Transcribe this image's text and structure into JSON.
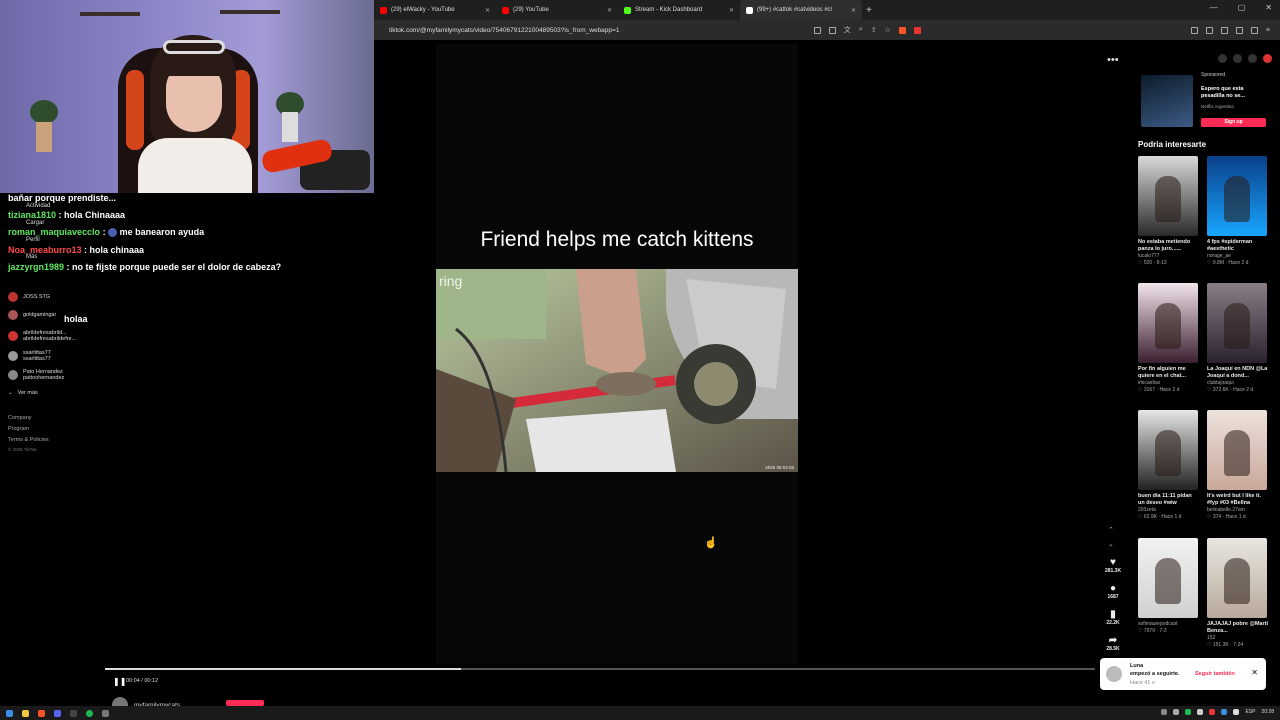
{
  "browser": {
    "tabs": [
      {
        "label": "(29) elWacky - YouTube",
        "color": "#ff0000",
        "active": false
      },
      {
        "label": "(29) YouTube",
        "color": "#ff0000",
        "active": false
      },
      {
        "label": "Stream - Kick Dashboard",
        "color": "#53fc18",
        "active": false
      },
      {
        "label": "(99+) #cattok #catvideos #cl",
        "color": "#ffffff",
        "active": true
      }
    ],
    "new_tab": "+",
    "url": "tiktok.com/@myfamilymycats/video/7540679122100489503?is_from_webapp=1"
  },
  "chat": {
    "lines": [
      {
        "user": "",
        "text": "bañar porque prendiste...",
        "user_color": "green"
      },
      {
        "user": "tiziana1810",
        "text": ": hola Chinaaaa",
        "user_color": "green"
      },
      {
        "user": "roman_maquiavecclo",
        "text": ":",
        "extra": "me banearon ayuda",
        "user_color": "green"
      },
      {
        "user": "Noa_meaburro13",
        "text": ": hola chinaaa",
        "user_color": "red"
      },
      {
        "user": "jazzyrgn1989",
        "text": ": no te fijste porque puede ser el dolor de cabeza?",
        "user_color": "green"
      },
      {
        "user": "",
        "text": "holaa",
        "user_color": "red"
      }
    ],
    "menu_items": [
      "Actividad",
      "Cargar",
      "Perfil",
      "Más"
    ],
    "following": [
      {
        "name": "JOSS STG"
      },
      {
        "name": "goldgamingar"
      },
      {
        "name": "abrildefresabrild...",
        "sub": "abrildefresabrildefre..."
      },
      {
        "name": "ssarlittas77",
        "sub": "ssarlittas77"
      },
      {
        "name": "Pato Hernandez",
        "sub": "pattoohernandez"
      }
    ],
    "see_more": "Ver más",
    "footer_links": [
      "Company",
      "Program",
      "Terms & Policies",
      "© 2025 TikTok"
    ]
  },
  "video": {
    "title": "Friend helps me catch kittens",
    "overlay_text": "ring",
    "stamp": "2025 05:04:03",
    "time": "00:04 / 00:12",
    "progress": 0.36,
    "creator": "myfamilymycats"
  },
  "actions": [
    {
      "icon": "heart-icon",
      "glyph": "♥",
      "count": "281.3K"
    },
    {
      "icon": "comment-icon",
      "glyph": "●",
      "count": "1687"
    },
    {
      "icon": "bookmark-icon",
      "glyph": "▮",
      "count": "22.2K"
    },
    {
      "icon": "share-icon",
      "glyph": "➦",
      "count": "28.5K"
    }
  ],
  "ad": {
    "sponsored": "Sponsored",
    "title": "Espero que esta pesadilla no se...",
    "sub": "Netflix Argentina",
    "button": "Sign up"
  },
  "recommendations": {
    "section_title": "Podría interesarte",
    "cards": [
      {
        "title": "No estaba metiendo panza lo juro......",
        "author": "lucalo777",
        "stats": "♡ 520 · 8-13",
        "colors": [
          "#d9d9d9",
          "#2a2a2a"
        ]
      },
      {
        "title": "4 fps #spiderman #aesthetic",
        "author": "norage_ae",
        "stats": "♡ 9.8M · Hace 2 d",
        "colors": [
          "#0a3f8a",
          "#18a6ff"
        ]
      },
      {
        "title": "Por fin alguien me quiere en el chat...",
        "author": "imicaeltax",
        "stats": "♡ 3167 · Hace 2 d",
        "colors": [
          "#f2e4ec",
          "#3b2030"
        ]
      },
      {
        "title": "La Joaquí en NDN @La Joaquí a dond...",
        "author": "clubtajoaqui",
        "stats": "♡ 372.6K · Hace 2 d",
        "colors": [
          "#8a7e86",
          "#2b2230"
        ]
      },
      {
        "title": "buen dia 11:11 pidan un deseo #wiw",
        "author": "203zeta",
        "stats": "♡ 62.9K · Hace 1 d",
        "colors": [
          "#e6e6e6",
          "#222"
        ]
      },
      {
        "title": "It's weird but I like it. #fyp #03 #Bellna",
        "author": "belinabelle.27am",
        "stats": "♡ 374 · Hace 1 d",
        "colors": [
          "#ece2dc",
          "#c9a79a"
        ]
      },
      {
        "title": "",
        "author": "sofimaurepodcast",
        "stats": "♡ 7979 · 7-2",
        "colors": [
          "#f2f2f2",
          "#d0d0d0"
        ]
      },
      {
        "title": "JAJAJAJ pobre @Marti Benza...",
        "author": "152",
        "stats": "♡ 151.3K · 7-24",
        "colors": [
          "#e8e6e0",
          "#b8a99a"
        ]
      }
    ]
  },
  "toast": {
    "name": "Luna",
    "message": "empezó a seguirte.",
    "time": "Hace 41 s",
    "follow_back": "Seguir también"
  },
  "taskbar": {
    "lang": "ESP",
    "time": "20:28"
  }
}
